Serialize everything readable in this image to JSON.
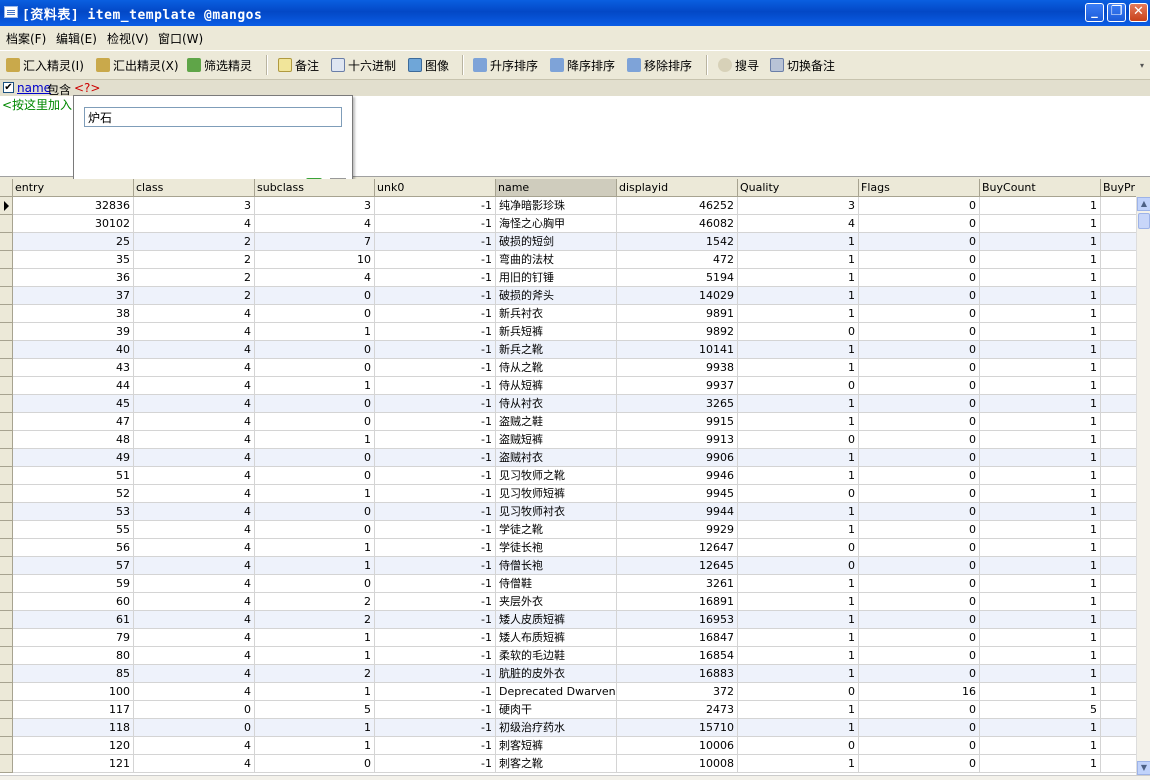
{
  "window": {
    "title": "[资料表] item_template @mangos"
  },
  "menu": [
    {
      "label": "档案(F)"
    },
    {
      "label": "编辑(E)"
    },
    {
      "label": "检视(V)"
    },
    {
      "label": "窗口(W)"
    }
  ],
  "toolbar": {
    "import_wizard": "汇入精灵(I)",
    "export_wizard": "汇出精灵(X)",
    "filter_wizard": "筛选精灵",
    "memo": "备注",
    "hex": "十六进制",
    "image": "图像",
    "sort_asc": "升序排序",
    "sort_desc": "降序排序",
    "remove_sort": "移除排序",
    "search": "搜寻",
    "toggle_memo": "切换备注"
  },
  "filter": {
    "field": "name",
    "operator": "包含",
    "value": "<?>",
    "add_hint": "<按这里加入>",
    "popup_value": "炉石"
  },
  "columns": [
    "entry",
    "class",
    "subclass",
    "unk0",
    "name",
    "displayid",
    "Quality",
    "Flags",
    "BuyCount",
    "BuyPri"
  ],
  "rows": [
    [
      "32836",
      "3",
      "3",
      "-1",
      "纯净暗影珍珠",
      "46252",
      "3",
      "0",
      "1"
    ],
    [
      "30102",
      "4",
      "4",
      "-1",
      "海怪之心胸甲",
      "46082",
      "4",
      "0",
      "1"
    ],
    [
      "25",
      "2",
      "7",
      "-1",
      "破损的短剑",
      "1542",
      "1",
      "0",
      "1"
    ],
    [
      "35",
      "2",
      "10",
      "-1",
      "弯曲的法杖",
      "472",
      "1",
      "0",
      "1"
    ],
    [
      "36",
      "2",
      "4",
      "-1",
      "用旧的钉锤",
      "5194",
      "1",
      "0",
      "1"
    ],
    [
      "37",
      "2",
      "0",
      "-1",
      "破损的斧头",
      "14029",
      "1",
      "0",
      "1"
    ],
    [
      "38",
      "4",
      "0",
      "-1",
      "新兵衬衣",
      "9891",
      "1",
      "0",
      "1"
    ],
    [
      "39",
      "4",
      "1",
      "-1",
      "新兵短裤",
      "9892",
      "0",
      "0",
      "1"
    ],
    [
      "40",
      "4",
      "0",
      "-1",
      "新兵之靴",
      "10141",
      "1",
      "0",
      "1"
    ],
    [
      "43",
      "4",
      "0",
      "-1",
      "侍从之靴",
      "9938",
      "1",
      "0",
      "1"
    ],
    [
      "44",
      "4",
      "1",
      "-1",
      "侍从短裤",
      "9937",
      "0",
      "0",
      "1"
    ],
    [
      "45",
      "4",
      "0",
      "-1",
      "侍从衬衣",
      "3265",
      "1",
      "0",
      "1"
    ],
    [
      "47",
      "4",
      "0",
      "-1",
      "盗贼之鞋",
      "9915",
      "1",
      "0",
      "1"
    ],
    [
      "48",
      "4",
      "1",
      "-1",
      "盗贼短裤",
      "9913",
      "0",
      "0",
      "1"
    ],
    [
      "49",
      "4",
      "0",
      "-1",
      "盗贼衬衣",
      "9906",
      "1",
      "0",
      "1"
    ],
    [
      "51",
      "4",
      "0",
      "-1",
      "见习牧师之靴",
      "9946",
      "1",
      "0",
      "1"
    ],
    [
      "52",
      "4",
      "1",
      "-1",
      "见习牧师短裤",
      "9945",
      "0",
      "0",
      "1"
    ],
    [
      "53",
      "4",
      "0",
      "-1",
      "见习牧师衬衣",
      "9944",
      "1",
      "0",
      "1"
    ],
    [
      "55",
      "4",
      "0",
      "-1",
      "学徒之靴",
      "9929",
      "1",
      "0",
      "1"
    ],
    [
      "56",
      "4",
      "1",
      "-1",
      "学徒长袍",
      "12647",
      "0",
      "0",
      "1"
    ],
    [
      "57",
      "4",
      "1",
      "-1",
      "侍僧长袍",
      "12645",
      "0",
      "0",
      "1"
    ],
    [
      "59",
      "4",
      "0",
      "-1",
      "侍僧鞋",
      "3261",
      "1",
      "0",
      "1"
    ],
    [
      "60",
      "4",
      "2",
      "-1",
      "夹层外衣",
      "16891",
      "1",
      "0",
      "1"
    ],
    [
      "61",
      "4",
      "2",
      "-1",
      "矮人皮质短裤",
      "16953",
      "1",
      "0",
      "1"
    ],
    [
      "79",
      "4",
      "1",
      "-1",
      "矮人布质短裤",
      "16847",
      "1",
      "0",
      "1"
    ],
    [
      "80",
      "4",
      "1",
      "-1",
      "柔软的毛边鞋",
      "16854",
      "1",
      "0",
      "1"
    ],
    [
      "85",
      "4",
      "2",
      "-1",
      "肮脏的皮外衣",
      "16883",
      "1",
      "0",
      "1"
    ],
    [
      "100",
      "4",
      "1",
      "-1",
      "Deprecated Dwarven Squire's Pants",
      "372",
      "0",
      "16",
      "1"
    ],
    [
      "117",
      "0",
      "5",
      "-1",
      "硬肉干",
      "2473",
      "1",
      "0",
      "5"
    ],
    [
      "118",
      "0",
      "1",
      "-1",
      "初级治疗药水",
      "15710",
      "1",
      "0",
      "1"
    ],
    [
      "120",
      "4",
      "1",
      "-1",
      "刺客短裤",
      "10006",
      "0",
      "0",
      "1"
    ],
    [
      "121",
      "4",
      "0",
      "-1",
      "刺客之靴",
      "10008",
      "1",
      "0",
      "1"
    ]
  ]
}
